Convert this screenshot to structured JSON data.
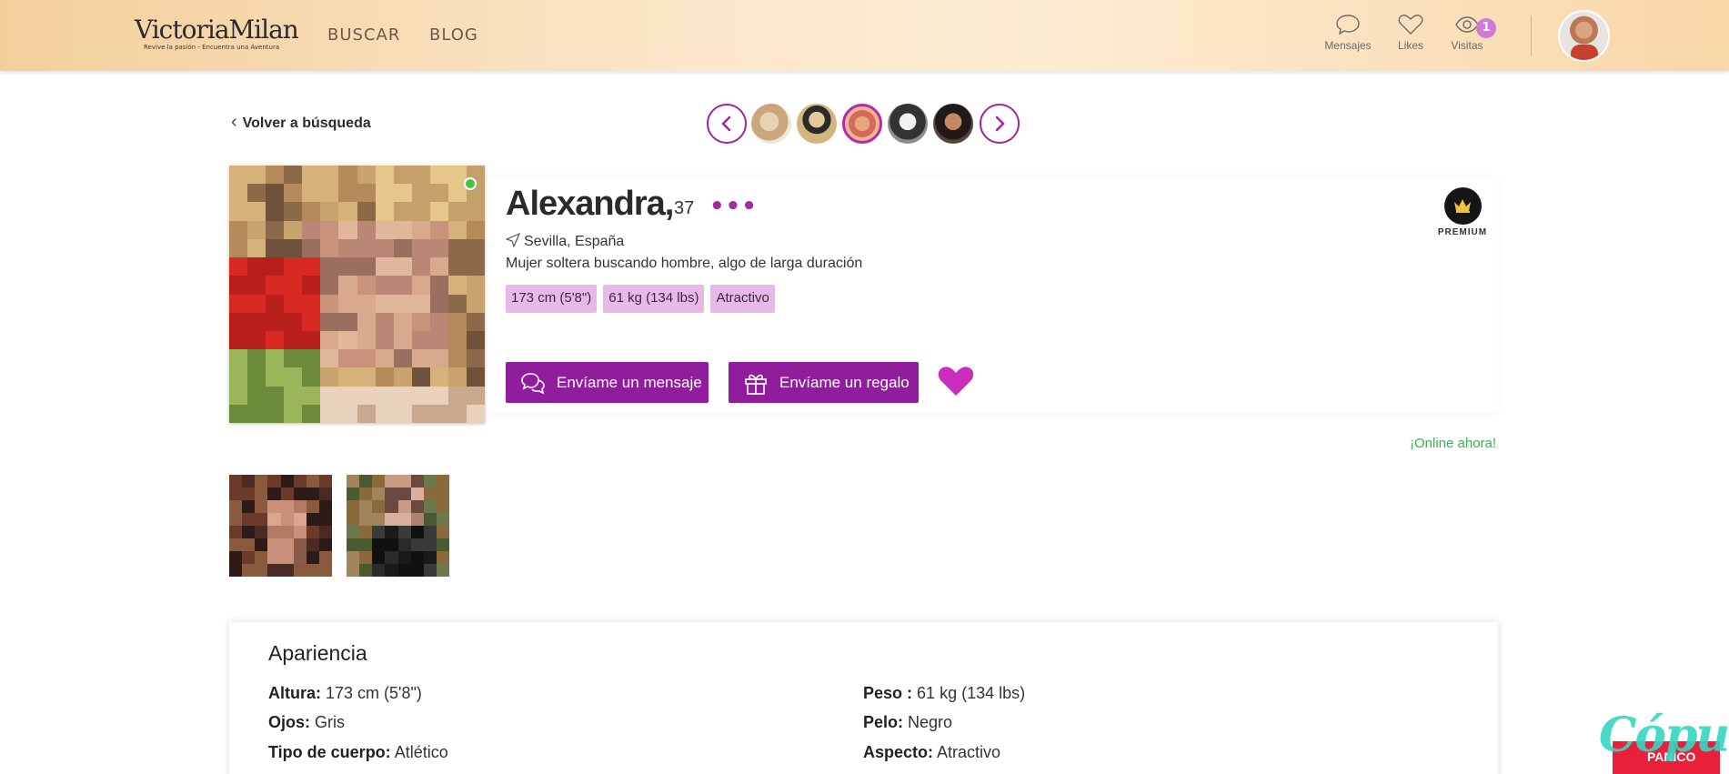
{
  "header": {
    "logo_main": "VictoriaMilan",
    "logo_tagline": "Revive la pasión - Encuentra una Aventura",
    "nav": [
      "BUSCAR",
      "BLOG"
    ],
    "icons": {
      "mensajes": "Mensajes",
      "likes": "Likes",
      "visitas": "Visitas",
      "visitas_badge": "1"
    }
  },
  "back_link": "Volver a búsqueda",
  "profile": {
    "name": "Alexandra,",
    "age": "37",
    "more": "•••",
    "location": "Sevilla, España",
    "tagline": "Mujer soltera buscando hombre, algo de larga duración",
    "chips": [
      "173 cm (5'8\")",
      "61 kg (134 lbs)",
      "Atractivo"
    ],
    "message_button": "Envíame un mensaje",
    "gift_button": "Envíame un regalo",
    "premium_label": "PREMIUM",
    "online_now": "¡Online ahora!"
  },
  "appearance": {
    "title": "Apariencia",
    "left": [
      {
        "label": "Altura:",
        "value": "173 cm (5'8\")"
      },
      {
        "label": "Ojos:",
        "value": "Gris"
      },
      {
        "label": "Tipo de cuerpo:",
        "value": "Atlético"
      }
    ],
    "right": [
      {
        "label": "Peso :",
        "value": "61 kg (134 lbs)"
      },
      {
        "label": "Pelo:",
        "value": "Negro"
      },
      {
        "label": "Aspecto:",
        "value": "Atractivo"
      }
    ]
  },
  "panic_button": "PANICO",
  "watermark": "Cópuli",
  "colors": {
    "accent": "#8f1d9c",
    "chip": "#e7b9e9",
    "online": "#37b24d",
    "panic": "#e8203a"
  }
}
